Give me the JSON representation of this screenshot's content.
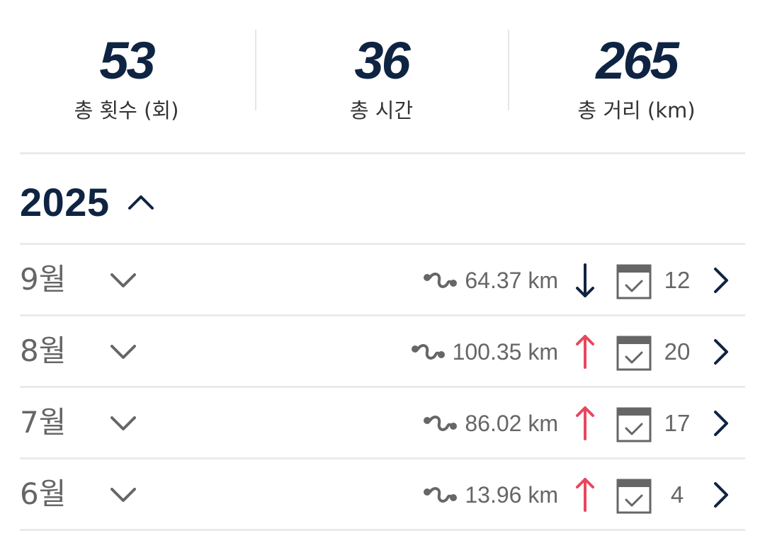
{
  "summary": {
    "total_count": {
      "value": "53",
      "label": "총 횟수 (회)"
    },
    "total_time": {
      "value": "36",
      "label": "총 시간"
    },
    "total_distance": {
      "value": "265",
      "label": "총 거리 (km)"
    }
  },
  "year_section": {
    "year": "2025",
    "toggle_icon": "chevron-up-icon",
    "months": [
      {
        "label": "9월",
        "distance": "64.37 km",
        "trend": "down",
        "count": "12"
      },
      {
        "label": "8월",
        "distance": "100.35 km",
        "trend": "up",
        "count": "20"
      },
      {
        "label": "7월",
        "distance": "86.02 km",
        "trend": "up",
        "count": "17"
      },
      {
        "label": "6월",
        "distance": "13.96 km",
        "trend": "up",
        "count": "4"
      }
    ]
  },
  "colors": {
    "navy": "#0f2442",
    "trend_up": "#e8475f",
    "trend_down": "#0f2442",
    "muted_text": "#666666",
    "divider": "#e8ebee"
  }
}
